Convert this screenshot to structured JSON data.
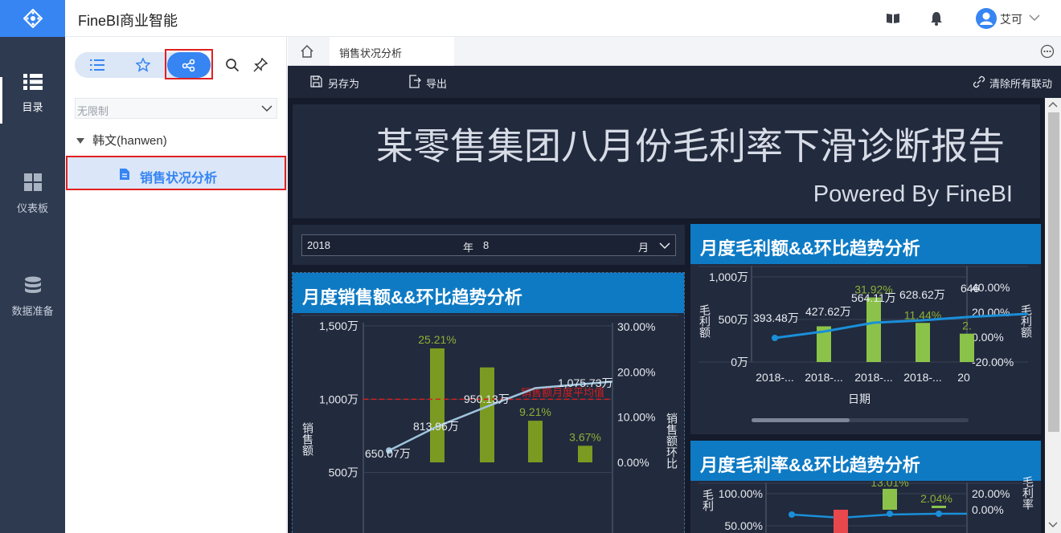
{
  "app": {
    "title": "FineBI商业智能",
    "user": "艾可"
  },
  "rail": [
    {
      "label": "目录",
      "icon": "catalog-icon"
    },
    {
      "label": "仪表板",
      "icon": "dashboard-icon"
    },
    {
      "label": "数据准备",
      "icon": "data-prep-icon"
    }
  ],
  "panel": {
    "filter": "无限制",
    "tree_user": "韩文(hanwen)",
    "tree_selected": "销售状况分析"
  },
  "tab": {
    "label": "销售状况分析"
  },
  "toolbar": {
    "save_as": "另存为",
    "export": "导出",
    "clear_links": "清除所有联动"
  },
  "report": {
    "title": "某零售集团八月份毛利率下滑诊断报告",
    "subtitle": "Powered By FineBI",
    "filter": {
      "year": "2018",
      "year_label": "年",
      "month": "8",
      "month_label": "月"
    }
  },
  "chart_data": [
    {
      "type": "bar",
      "title": "月度销售额&&环比趋势分析",
      "ylabel": "销售额",
      "y2label": "销售额环比",
      "ylim": [
        0,
        1500
      ],
      "y_ticks": [
        "1,500万",
        "1,000万",
        "500万"
      ],
      "y2_ticks": [
        "30.00%",
        "20.00%",
        "10.00%",
        "0.00%"
      ],
      "series": [
        {
          "type": "line",
          "values": [
            650.07,
            813.96,
            950.13,
            1075.73
          ],
          "labels": [
            "650.07万",
            "813.96万",
            "950.13万",
            "1,075.73万"
          ]
        },
        {
          "type": "bar",
          "values": [
            25.21,
            21.0,
            9.21,
            3.67
          ],
          "labels": [
            "25.21%",
            "",
            "9.21%",
            "3.67%"
          ]
        }
      ],
      "reference_line": {
        "label": "销售额月度平均值",
        "value": 1000
      }
    },
    {
      "type": "bar",
      "title": "月度毛利额&&环比趋势分析",
      "xlabel": "日期",
      "ylabel": "毛利额",
      "y2label": "毛利额",
      "y_ticks": [
        "1,000万",
        "500万",
        "0万"
      ],
      "y2_ticks": [
        "40.00%",
        "20.00%",
        "0.00%",
        "-20.00%"
      ],
      "categories": [
        "2018-...",
        "2018-...",
        "2018-...",
        "2018-...",
        "20"
      ],
      "series": [
        {
          "type": "line",
          "values": [
            393.48,
            427.62,
            564.11,
            628.62,
            646
          ],
          "labels": [
            "393.48万",
            "427.62万",
            "564.11万",
            "628.62万",
            "646"
          ]
        },
        {
          "type": "bar",
          "values": [
            8.7,
            31.92,
            11.44,
            2.8
          ],
          "labels": [
            "",
            "31.92%",
            "11.44%",
            "2."
          ]
        }
      ]
    },
    {
      "type": "bar",
      "title": "月度毛利率&&环比趋势分析",
      "ylabel": "毛利",
      "y2label": "毛利率",
      "y_ticks": [
        "100.00%",
        "50.00%"
      ],
      "y2_ticks": [
        "20.00%",
        "0.00%"
      ],
      "series": [
        {
          "type": "bar",
          "values": [
            -10,
            13.01,
            2.04
          ],
          "labels": [
            "",
            "13.01%",
            "2.04%"
          ]
        }
      ]
    }
  ]
}
